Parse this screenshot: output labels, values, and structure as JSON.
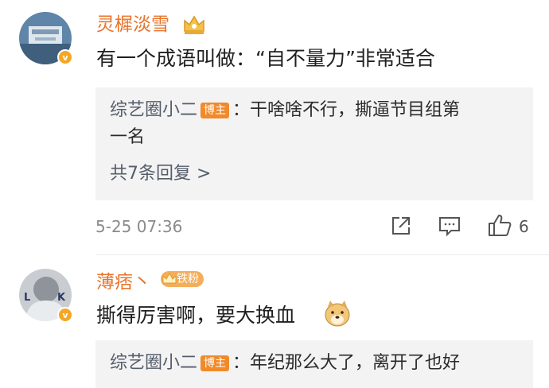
{
  "comments": [
    {
      "username": "灵樨淡雪",
      "text": "有一个成语叫做：“自不量力”非常适合",
      "reply": {
        "name": "综艺圈小二",
        "tag": "博主",
        "text_line1": "：干啥啥不行，撕逼节目组第",
        "text_line2": "一名"
      },
      "more_replies": "共7条回复 >",
      "timestamp": "5-25 07:36",
      "like_count": "6"
    },
    {
      "username": "薄痞丶",
      "fan_badge": "铁粉",
      "text": "撕得厉害啊，要大换血",
      "reply": {
        "name": "综艺圈小二",
        "tag": "博主",
        "text_line1": "：年纪那么大了，离开了也好"
      }
    }
  ],
  "colors": {
    "username": "#e8742b",
    "reply_name": "#555d6b",
    "reply_bg": "#f3f3f3",
    "verified_badge": "#f5a623"
  }
}
